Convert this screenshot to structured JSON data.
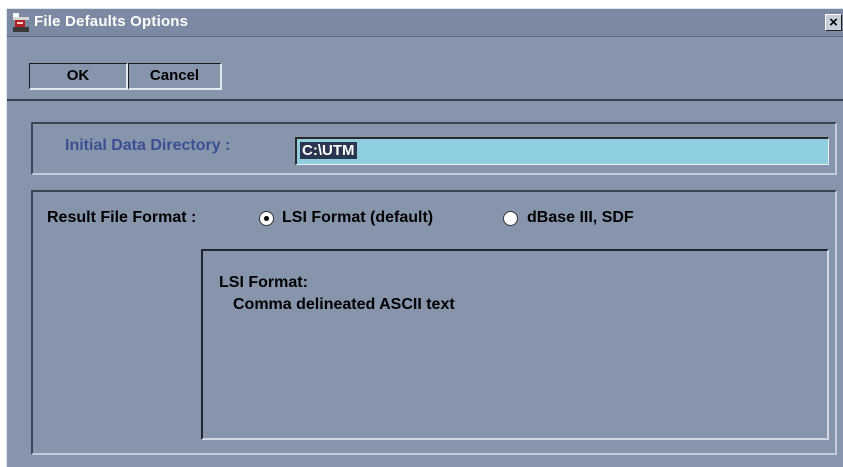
{
  "window": {
    "title": "File Defaults Options",
    "close_glyph": "×"
  },
  "toolbar": {
    "ok_label": "OK",
    "cancel_label": "Cancel"
  },
  "directory": {
    "label": "Initial Data Directory :",
    "value": "C:\\UTM"
  },
  "result_format": {
    "label": "Result File Format :",
    "options": [
      {
        "label": "LSI Format (default)",
        "selected": true
      },
      {
        "label": "dBase III, SDF",
        "selected": false
      }
    ],
    "description_title": "LSI Format:",
    "description_text": "Comma delineated ASCII text"
  },
  "colors": {
    "window_bg": "#8695ac",
    "input_bg": "#8fcede",
    "label_blue": "#3b4f93"
  },
  "icons": {
    "app": "app-icon",
    "close": "close-icon"
  }
}
